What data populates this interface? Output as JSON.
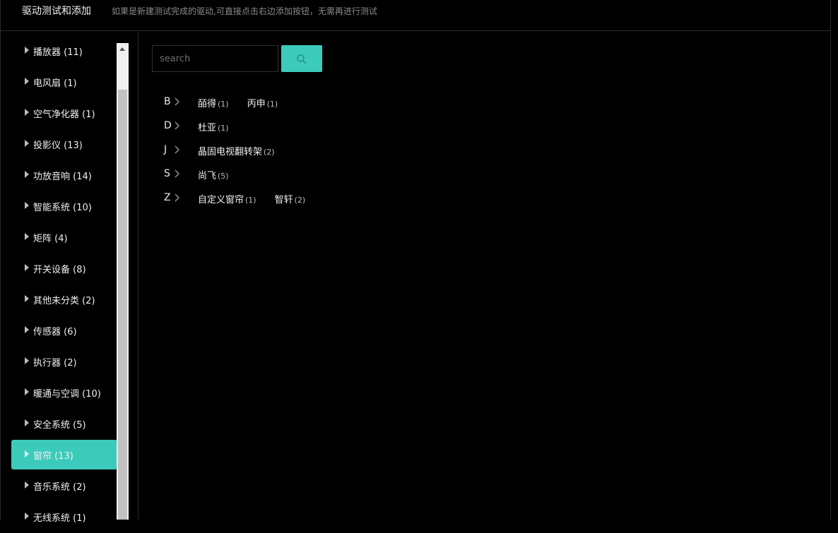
{
  "header": {
    "title": "驱动测试和添加",
    "subtitle": "如果是新建测试完成的驱动,可直接点击右边添加按钮，无需再进行测试"
  },
  "sidebar": {
    "items": [
      {
        "label": "播放器 (11)",
        "active": false
      },
      {
        "label": "电风扇 (1)",
        "active": false
      },
      {
        "label": "空气净化器 (1)",
        "active": false
      },
      {
        "label": "投影仪 (13)",
        "active": false
      },
      {
        "label": "功放音响 (14)",
        "active": false
      },
      {
        "label": "智能系统 (10)",
        "active": false
      },
      {
        "label": "矩阵 (4)",
        "active": false
      },
      {
        "label": "开关设备 (8)",
        "active": false
      },
      {
        "label": "其他未分类 (2)",
        "active": false
      },
      {
        "label": "传感器 (6)",
        "active": false
      },
      {
        "label": "执行器 (2)",
        "active": false
      },
      {
        "label": "暖通与空调 (10)",
        "active": false
      },
      {
        "label": "安全系统 (5)",
        "active": false
      },
      {
        "label": "窗帘 (13)",
        "active": true
      },
      {
        "label": "音乐系统 (2)",
        "active": false
      },
      {
        "label": "无线系统 (1)",
        "active": false
      }
    ]
  },
  "search": {
    "placeholder": "search",
    "value": "",
    "button_icon": "search-icon"
  },
  "brands": [
    {
      "letter": "B",
      "items": [
        {
          "name": "皕得",
          "count": "(1)"
        },
        {
          "name": "丙申",
          "count": "(1)"
        }
      ]
    },
    {
      "letter": "D",
      "items": [
        {
          "name": "杜亚",
          "count": "(1)"
        }
      ]
    },
    {
      "letter": "J",
      "items": [
        {
          "name": "晶固电视翻转架",
          "count": "(2)"
        }
      ]
    },
    {
      "letter": "S",
      "items": [
        {
          "name": "尚飞",
          "count": "(5)"
        }
      ]
    },
    {
      "letter": "Z",
      "items": [
        {
          "name": "自定义窗帘",
          "count": "(1)"
        },
        {
          "name": "智轩",
          "count": "(2)"
        }
      ]
    }
  ],
  "colors": {
    "accent": "#3ccbbb",
    "background": "#000000"
  }
}
